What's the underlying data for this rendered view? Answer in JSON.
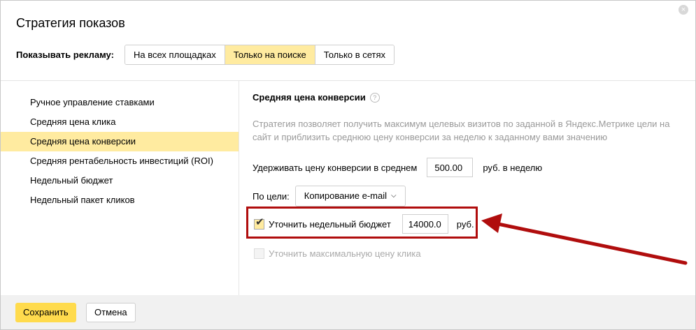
{
  "dialog": {
    "title": "Стратегия показов",
    "close_label": "×"
  },
  "placement": {
    "label": "Показывать рекламу:",
    "options": [
      "На всех площадках",
      "Только на поиске",
      "Только в сетях"
    ],
    "selected": "Только на поиске"
  },
  "strategies": {
    "items": [
      "Ручное управление ставками",
      "Средняя цена клика",
      "Средняя цена конверсии",
      "Средняя рентабельность инвестиций (ROI)",
      "Недельный бюджет",
      "Недельный пакет кликов"
    ],
    "selected": "Средняя цена конверсии"
  },
  "details": {
    "title": "Средняя цена конверсии",
    "help_icon": "?",
    "description": "Стратегия позволяет получить максимум целевых визитов по заданной в Яндекс.Метрике цели на сайт и приблизить среднюю цену конверсии за неделю к заданному вами значению",
    "hold_label": "Удерживать цену конверсии в среднем",
    "hold_value": "500.00",
    "hold_unit": "руб. в неделю",
    "goal_label": "По цели:",
    "goal_value": "Копирование e-mail",
    "budget_label": "Уточнить недельный бюджет",
    "budget_checked": true,
    "budget_value": "14000.0",
    "budget_unit": "руб.",
    "max_click_label": "Уточнить максимальную цену клика",
    "max_click_checked": false
  },
  "footer": {
    "save_label": "Сохранить",
    "cancel_label": "Отмена"
  },
  "colors": {
    "accent": "#ffeba0",
    "save_button": "#ffdb4d",
    "highlight": "#b00d0d"
  }
}
